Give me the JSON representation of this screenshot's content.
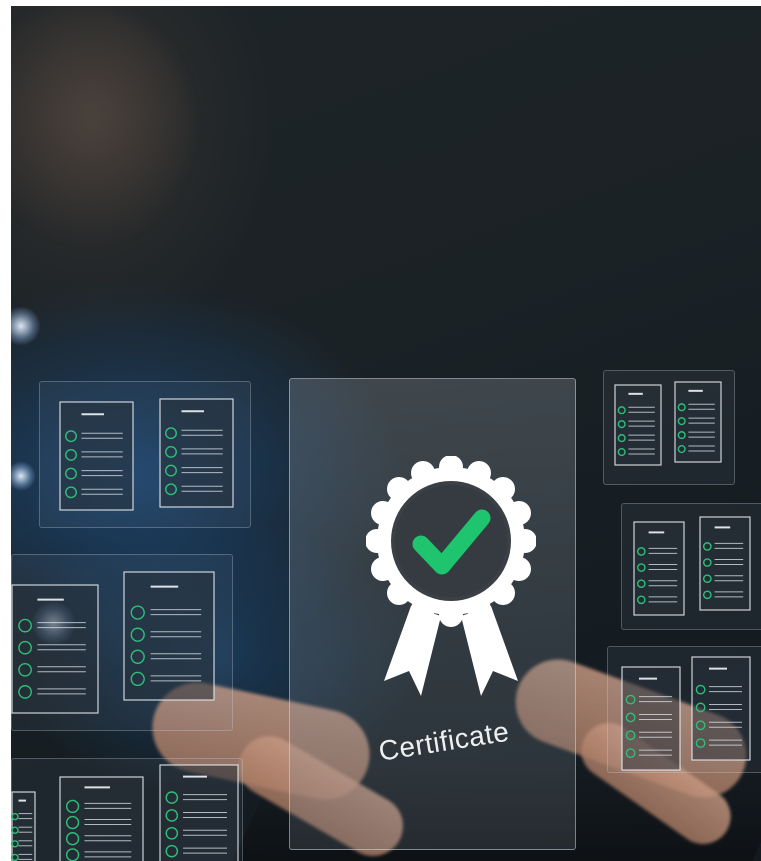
{
  "image": {
    "center_card_label": "Certificate",
    "seal_icon": "award-ribbon-checkmark-icon",
    "document_icon": "checklist-document-icon",
    "colors": {
      "background": "#1b2226",
      "accent_check": "#1fc46e",
      "panel_border": "#d2dce6",
      "seal_white": "#ffffff"
    }
  }
}
